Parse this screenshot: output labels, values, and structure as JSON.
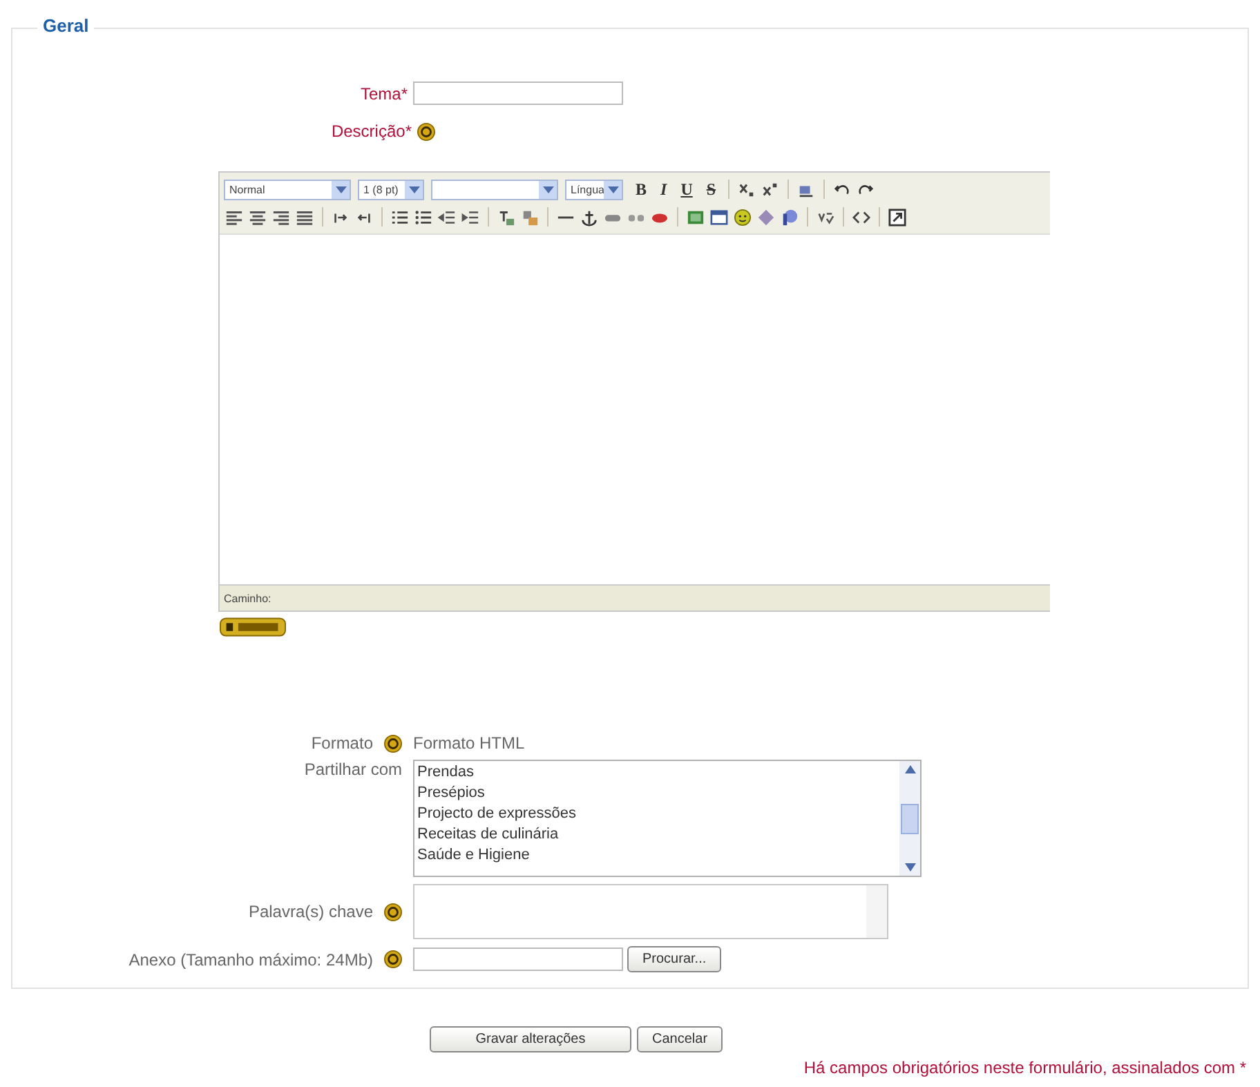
{
  "fieldset": {
    "legend": "Geral"
  },
  "topic": {
    "label": "Tema",
    "required_mark": "*",
    "required": true
  },
  "description": {
    "label": "Descrição",
    "required_mark": "*",
    "required": true,
    "help": true
  },
  "editor": {
    "selects": [
      {
        "value": "Normal",
        "kind": "wide"
      },
      {
        "value": "1 (8 pt)",
        "kind": "narrow"
      },
      {
        "kind": "wide"
      },
      {
        "value": "Língua",
        "kind": "small"
      }
    ],
    "format_buttons": [
      {
        "label": "B",
        "kind": "bold"
      },
      {
        "label": "I",
        "kind": "italic"
      },
      {
        "label": "U",
        "kind": "underline"
      },
      {
        "label": "S",
        "kind": "strike"
      }
    ],
    "path_label": "Caminho:"
  },
  "fields": [
    {
      "kind": "text",
      "label": "Formato",
      "help": true,
      "value": "Formato HTML"
    },
    {
      "kind": "list",
      "label": "Partilhar com",
      "help": false,
      "options": [
        {
          "label": "Prendas",
          "selected": false
        },
        {
          "label": "Presépios",
          "selected": false
        },
        {
          "label": "Projecto de expressões",
          "selected": false
        },
        {
          "label": "Receitas de culinária",
          "selected": false
        },
        {
          "label": "Saúde e Higiene",
          "selected": false
        }
      ]
    },
    {
      "kind": "textarea",
      "label": "Palavra(s) chave",
      "help": true
    },
    {
      "kind": "file",
      "label": "Anexo (Tamanho máximo: 24Mb)",
      "help": true,
      "button": "Procurar..."
    }
  ],
  "buttons": [
    "Gravar alterações",
    "Cancelar"
  ],
  "required_note": "Há campos obrigatórios neste formulário, assinalados com *"
}
